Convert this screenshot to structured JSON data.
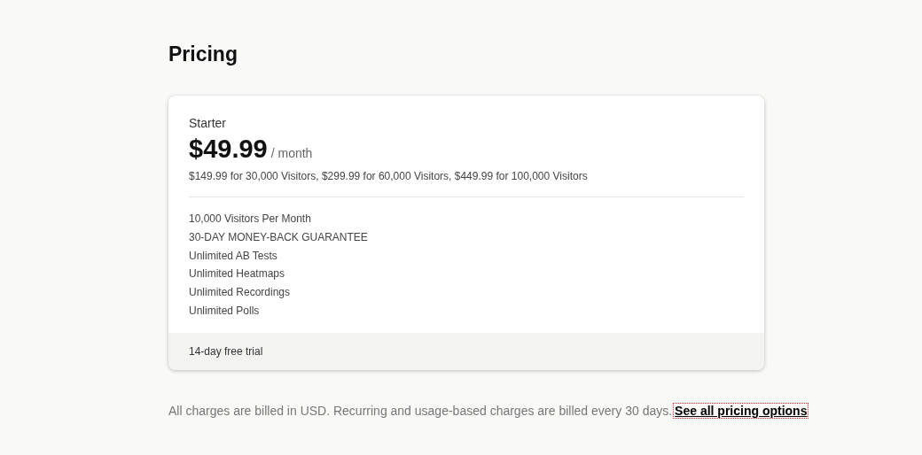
{
  "heading": "Pricing",
  "plan": {
    "name": "Starter",
    "price": "$49.99",
    "period": "/ month",
    "tiers": "$149.99 for 30,000 Visitors, $299.99 for 60,000 Visitors, $449.99 for 100,000 Visitors",
    "features": [
      "10,000 Visitors Per Month",
      "30-DAY MONEY-BACK GUARANTEE",
      "Unlimited AB Tests",
      "Unlimited Heatmaps",
      "Unlimited Recordings",
      "Unlimited Polls"
    ],
    "footer": "14-day free trial"
  },
  "note": {
    "text": "All charges are billed in USD. Recurring and usage-based charges are billed every 30 days.",
    "link": {
      "label": "See all pricing options",
      "focused": true
    }
  }
}
